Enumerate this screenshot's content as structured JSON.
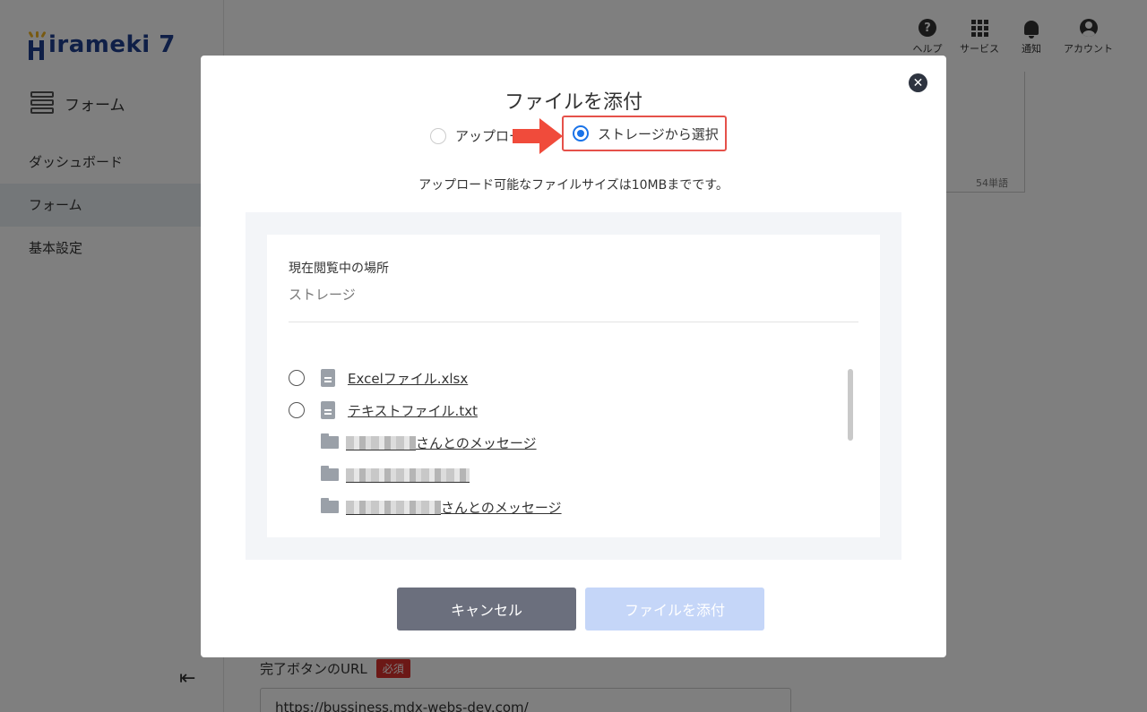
{
  "brand": {
    "logo_text": "irameki 7"
  },
  "sidebar": {
    "section_title": "フォーム",
    "items": [
      {
        "label": "ダッシュボード",
        "active": false
      },
      {
        "label": "フォーム",
        "active": true
      },
      {
        "label": "基本設定",
        "active": false
      }
    ],
    "collapse_icon": "⇤"
  },
  "header": {
    "icons": [
      {
        "name": "help-icon",
        "label": "ヘルプ"
      },
      {
        "name": "services-icon",
        "label": "サービス"
      },
      {
        "name": "notification-icon",
        "label": "通知"
      },
      {
        "name": "account-icon",
        "label": "アカウント"
      }
    ]
  },
  "background_form": {
    "word_count": "54単語",
    "completion_url_label": "完了ボタンのURL",
    "required_badge": "必須",
    "completion_url_value": "https://bussiness.mdx-webs-dev.com/"
  },
  "modal": {
    "title": "ファイルを添付",
    "options": {
      "upload_label": "アップロー",
      "storage_label": "ストレージから選択",
      "selected": "storage"
    },
    "size_note": "アップロード可能なファイルサイズは10MBまでです。",
    "browser": {
      "location_label": "現在閲覧中の場所",
      "location_value": "ストレージ",
      "files": [
        {
          "name": "Excelファイル.xlsx"
        },
        {
          "name": "テキストファイル.txt"
        }
      ],
      "folders": [
        {
          "suffix": "さんとのメッセージ"
        },
        {
          "suffix": ""
        },
        {
          "suffix": "さんとのメッセージ"
        }
      ]
    },
    "buttons": {
      "cancel": "キャンセル",
      "attach": "ファイルを添付"
    }
  },
  "colors": {
    "accent": "#1a73e8",
    "highlight": "#e5514a",
    "brand": "#1f3f8f",
    "cancel_bg": "#6b6f7d",
    "attach_disabled_bg": "#c5d6f8"
  }
}
